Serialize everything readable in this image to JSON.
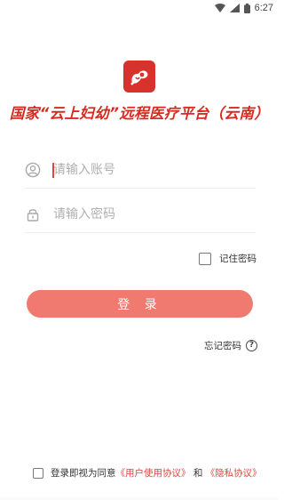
{
  "status_bar": {
    "time": "6:27"
  },
  "header": {
    "title": "国家“云上妇幼”远程医疗平台（云南）"
  },
  "login_form": {
    "account_placeholder": "请输入账号",
    "password_placeholder": "请输入密码",
    "remember_label": "记住密码",
    "remember_checked": false,
    "login_button_label": "登 录",
    "forgot_password_label": "忘记密码"
  },
  "agreement": {
    "prefix": "登录即视为同意",
    "user_agreement_link": "《用户使用协议》",
    "and": "和",
    "privacy_link": "《隐私协议》",
    "checked": false
  },
  "colors": {
    "brand": "#d52b22",
    "button": "#f17a70",
    "link": "#e0453d"
  }
}
